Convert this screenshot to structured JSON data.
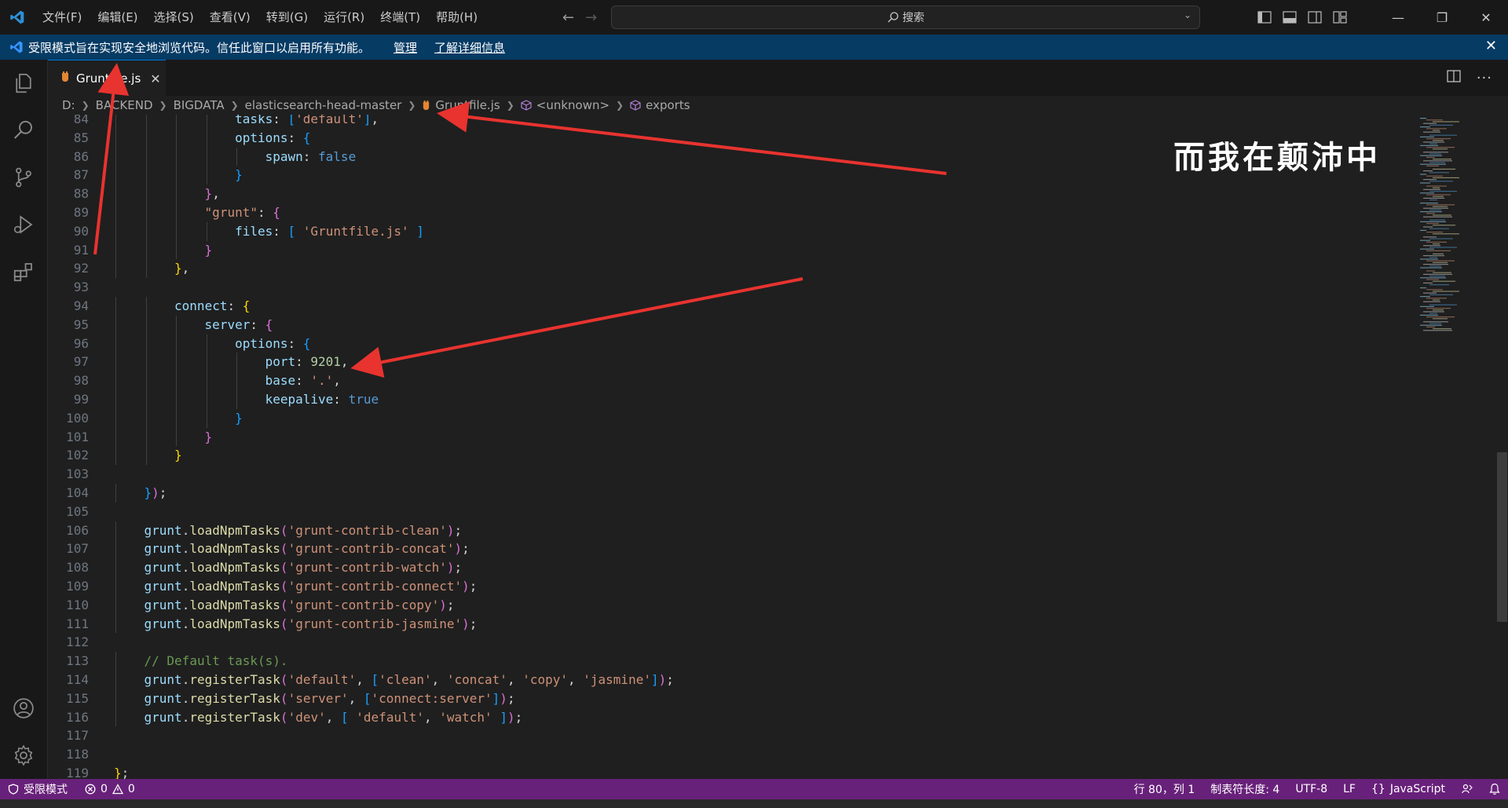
{
  "menu": [
    "文件(F)",
    "编辑(E)",
    "选择(S)",
    "查看(V)",
    "转到(G)",
    "运行(R)",
    "终端(T)",
    "帮助(H)"
  ],
  "search": {
    "label": "搜索"
  },
  "banner": {
    "message": "受限模式旨在实现安全地浏览代码。信任此窗口以启用所有功能。",
    "manage_link": "管理",
    "learn_more_link": "了解详细信息"
  },
  "tab": {
    "filename": "Gruntfile.js"
  },
  "breadcrumb": [
    "D:",
    "BACKEND",
    "BIGDATA",
    "elasticsearch-head-master",
    "Gruntfile.js",
    "<unknown>",
    "exports"
  ],
  "watermark": "而我在颠沛中",
  "colors": {
    "keyword": "#569cd6",
    "property": "#9cdcfe",
    "string": "#ce9178",
    "number": "#b5cea8",
    "function": "#dcdcaa",
    "comment": "#6a9955",
    "plain": "#d4d4d4",
    "bracket1": "#ffd700",
    "bracket2": "#da70d6",
    "bracket3": "#179fff",
    "accent": "#0078d4",
    "statusbar": "#68217a",
    "arrow": "#e8332f"
  },
  "code_lines": [
    {
      "n": 84,
      "indent": 4,
      "tokens": [
        [
          "tasks",
          "property"
        ],
        [
          ": ",
          "plain"
        ],
        [
          "[",
          "bracket3"
        ],
        [
          "'default'",
          "string"
        ],
        [
          "]",
          "bracket3"
        ],
        [
          ",",
          "plain"
        ]
      ]
    },
    {
      "n": 85,
      "indent": 4,
      "tokens": [
        [
          "options",
          "property"
        ],
        [
          ": ",
          "plain"
        ],
        [
          "{",
          "bracket3"
        ]
      ]
    },
    {
      "n": 86,
      "indent": 5,
      "tokens": [
        [
          "spawn",
          "property"
        ],
        [
          ": ",
          "plain"
        ],
        [
          "false",
          "keyword"
        ]
      ]
    },
    {
      "n": 87,
      "indent": 4,
      "tokens": [
        [
          "}",
          "bracket3"
        ]
      ]
    },
    {
      "n": 88,
      "indent": 3,
      "tokens": [
        [
          "}",
          "bracket2"
        ],
        [
          ",",
          "plain"
        ]
      ]
    },
    {
      "n": 89,
      "indent": 3,
      "tokens": [
        [
          "\"grunt\"",
          "string"
        ],
        [
          ": ",
          "plain"
        ],
        [
          "{",
          "bracket2"
        ]
      ]
    },
    {
      "n": 90,
      "indent": 4,
      "tokens": [
        [
          "files",
          "property"
        ],
        [
          ": ",
          "plain"
        ],
        [
          "[",
          "bracket3"
        ],
        [
          " ",
          "plain"
        ],
        [
          "'Gruntfile.js'",
          "string"
        ],
        [
          " ",
          "plain"
        ],
        [
          "]",
          "bracket3"
        ]
      ]
    },
    {
      "n": 91,
      "indent": 3,
      "tokens": [
        [
          "}",
          "bracket2"
        ]
      ]
    },
    {
      "n": 92,
      "indent": 2,
      "tokens": [
        [
          "}",
          "bracket1"
        ],
        [
          ",",
          "plain"
        ]
      ]
    },
    {
      "n": 93,
      "indent": 0,
      "tokens": []
    },
    {
      "n": 94,
      "indent": 2,
      "tokens": [
        [
          "connect",
          "property"
        ],
        [
          ": ",
          "plain"
        ],
        [
          "{",
          "bracket1"
        ]
      ]
    },
    {
      "n": 95,
      "indent": 3,
      "tokens": [
        [
          "server",
          "property"
        ],
        [
          ": ",
          "plain"
        ],
        [
          "{",
          "bracket2"
        ]
      ]
    },
    {
      "n": 96,
      "indent": 4,
      "tokens": [
        [
          "options",
          "property"
        ],
        [
          ": ",
          "plain"
        ],
        [
          "{",
          "bracket3"
        ]
      ]
    },
    {
      "n": 97,
      "indent": 5,
      "tokens": [
        [
          "port",
          "property"
        ],
        [
          ": ",
          "plain"
        ],
        [
          "9201",
          "number"
        ],
        [
          ",",
          "plain"
        ]
      ]
    },
    {
      "n": 98,
      "indent": 5,
      "tokens": [
        [
          "base",
          "property"
        ],
        [
          ": ",
          "plain"
        ],
        [
          "'.'",
          "string"
        ],
        [
          ",",
          "plain"
        ]
      ]
    },
    {
      "n": 99,
      "indent": 5,
      "tokens": [
        [
          "keepalive",
          "property"
        ],
        [
          ": ",
          "plain"
        ],
        [
          "true",
          "keyword"
        ]
      ]
    },
    {
      "n": 100,
      "indent": 4,
      "tokens": [
        [
          "}",
          "bracket3"
        ]
      ]
    },
    {
      "n": 101,
      "indent": 3,
      "tokens": [
        [
          "}",
          "bracket2"
        ]
      ]
    },
    {
      "n": 102,
      "indent": 2,
      "tokens": [
        [
          "}",
          "bracket1"
        ]
      ]
    },
    {
      "n": 103,
      "indent": 0,
      "tokens": []
    },
    {
      "n": 104,
      "indent": 1,
      "tokens": [
        [
          "}",
          "bracket3"
        ],
        [
          ")",
          "bracket2"
        ],
        [
          ";",
          "plain"
        ]
      ]
    },
    {
      "n": 105,
      "indent": 0,
      "tokens": []
    },
    {
      "n": 106,
      "indent": 1,
      "tokens": [
        [
          "grunt",
          "property"
        ],
        [
          ".",
          "plain"
        ],
        [
          "loadNpmTasks",
          "function"
        ],
        [
          "(",
          "bracket2"
        ],
        [
          "'grunt-contrib-clean'",
          "string"
        ],
        [
          ")",
          "bracket2"
        ],
        [
          ";",
          "plain"
        ]
      ]
    },
    {
      "n": 107,
      "indent": 1,
      "tokens": [
        [
          "grunt",
          "property"
        ],
        [
          ".",
          "plain"
        ],
        [
          "loadNpmTasks",
          "function"
        ],
        [
          "(",
          "bracket2"
        ],
        [
          "'grunt-contrib-concat'",
          "string"
        ],
        [
          ")",
          "bracket2"
        ],
        [
          ";",
          "plain"
        ]
      ]
    },
    {
      "n": 108,
      "indent": 1,
      "tokens": [
        [
          "grunt",
          "property"
        ],
        [
          ".",
          "plain"
        ],
        [
          "loadNpmTasks",
          "function"
        ],
        [
          "(",
          "bracket2"
        ],
        [
          "'grunt-contrib-watch'",
          "string"
        ],
        [
          ")",
          "bracket2"
        ],
        [
          ";",
          "plain"
        ]
      ]
    },
    {
      "n": 109,
      "indent": 1,
      "tokens": [
        [
          "grunt",
          "property"
        ],
        [
          ".",
          "plain"
        ],
        [
          "loadNpmTasks",
          "function"
        ],
        [
          "(",
          "bracket2"
        ],
        [
          "'grunt-contrib-connect'",
          "string"
        ],
        [
          ")",
          "bracket2"
        ],
        [
          ";",
          "plain"
        ]
      ]
    },
    {
      "n": 110,
      "indent": 1,
      "tokens": [
        [
          "grunt",
          "property"
        ],
        [
          ".",
          "plain"
        ],
        [
          "loadNpmTasks",
          "function"
        ],
        [
          "(",
          "bracket2"
        ],
        [
          "'grunt-contrib-copy'",
          "string"
        ],
        [
          ")",
          "bracket2"
        ],
        [
          ";",
          "plain"
        ]
      ]
    },
    {
      "n": 111,
      "indent": 1,
      "tokens": [
        [
          "grunt",
          "property"
        ],
        [
          ".",
          "plain"
        ],
        [
          "loadNpmTasks",
          "function"
        ],
        [
          "(",
          "bracket2"
        ],
        [
          "'grunt-contrib-jasmine'",
          "string"
        ],
        [
          ")",
          "bracket2"
        ],
        [
          ";",
          "plain"
        ]
      ]
    },
    {
      "n": 112,
      "indent": 0,
      "tokens": []
    },
    {
      "n": 113,
      "indent": 1,
      "tokens": [
        [
          "// Default task(s).",
          "comment"
        ]
      ]
    },
    {
      "n": 114,
      "indent": 1,
      "tokens": [
        [
          "grunt",
          "property"
        ],
        [
          ".",
          "plain"
        ],
        [
          "registerTask",
          "function"
        ],
        [
          "(",
          "bracket2"
        ],
        [
          "'default'",
          "string"
        ],
        [
          ", ",
          "plain"
        ],
        [
          "[",
          "bracket3"
        ],
        [
          "'clean'",
          "string"
        ],
        [
          ", ",
          "plain"
        ],
        [
          "'concat'",
          "string"
        ],
        [
          ", ",
          "plain"
        ],
        [
          "'copy'",
          "string"
        ],
        [
          ", ",
          "plain"
        ],
        [
          "'jasmine'",
          "string"
        ],
        [
          "]",
          "bracket3"
        ],
        [
          ")",
          "bracket2"
        ],
        [
          ";",
          "plain"
        ]
      ]
    },
    {
      "n": 115,
      "indent": 1,
      "tokens": [
        [
          "grunt",
          "property"
        ],
        [
          ".",
          "plain"
        ],
        [
          "registerTask",
          "function"
        ],
        [
          "(",
          "bracket2"
        ],
        [
          "'server'",
          "string"
        ],
        [
          ", ",
          "plain"
        ],
        [
          "[",
          "bracket3"
        ],
        [
          "'connect:server'",
          "string"
        ],
        [
          "]",
          "bracket3"
        ],
        [
          ")",
          "bracket2"
        ],
        [
          ";",
          "plain"
        ]
      ]
    },
    {
      "n": 116,
      "indent": 1,
      "tokens": [
        [
          "grunt",
          "property"
        ],
        [
          ".",
          "plain"
        ],
        [
          "registerTask",
          "function"
        ],
        [
          "(",
          "bracket2"
        ],
        [
          "'dev'",
          "string"
        ],
        [
          ", ",
          "plain"
        ],
        [
          "[",
          "bracket3"
        ],
        [
          " ",
          "plain"
        ],
        [
          "'default'",
          "string"
        ],
        [
          ", ",
          "plain"
        ],
        [
          "'watch'",
          "string"
        ],
        [
          " ",
          "plain"
        ],
        [
          "]",
          "bracket3"
        ],
        [
          ")",
          "bracket2"
        ],
        [
          ";",
          "plain"
        ]
      ]
    },
    {
      "n": 117,
      "indent": 0,
      "tokens": []
    },
    {
      "n": 118,
      "indent": 0,
      "tokens": []
    },
    {
      "n": 119,
      "indent": 0,
      "tokens": [
        [
          "}",
          "bracket1"
        ],
        [
          ";",
          "plain"
        ]
      ]
    }
  ],
  "status": {
    "restricted": "受限模式",
    "errors": "0",
    "warnings": "0",
    "cursor": "行 80，列 1",
    "tab_size": "制表符长度: 4",
    "encoding": "UTF-8",
    "eol": "LF",
    "language": "JavaScript"
  }
}
